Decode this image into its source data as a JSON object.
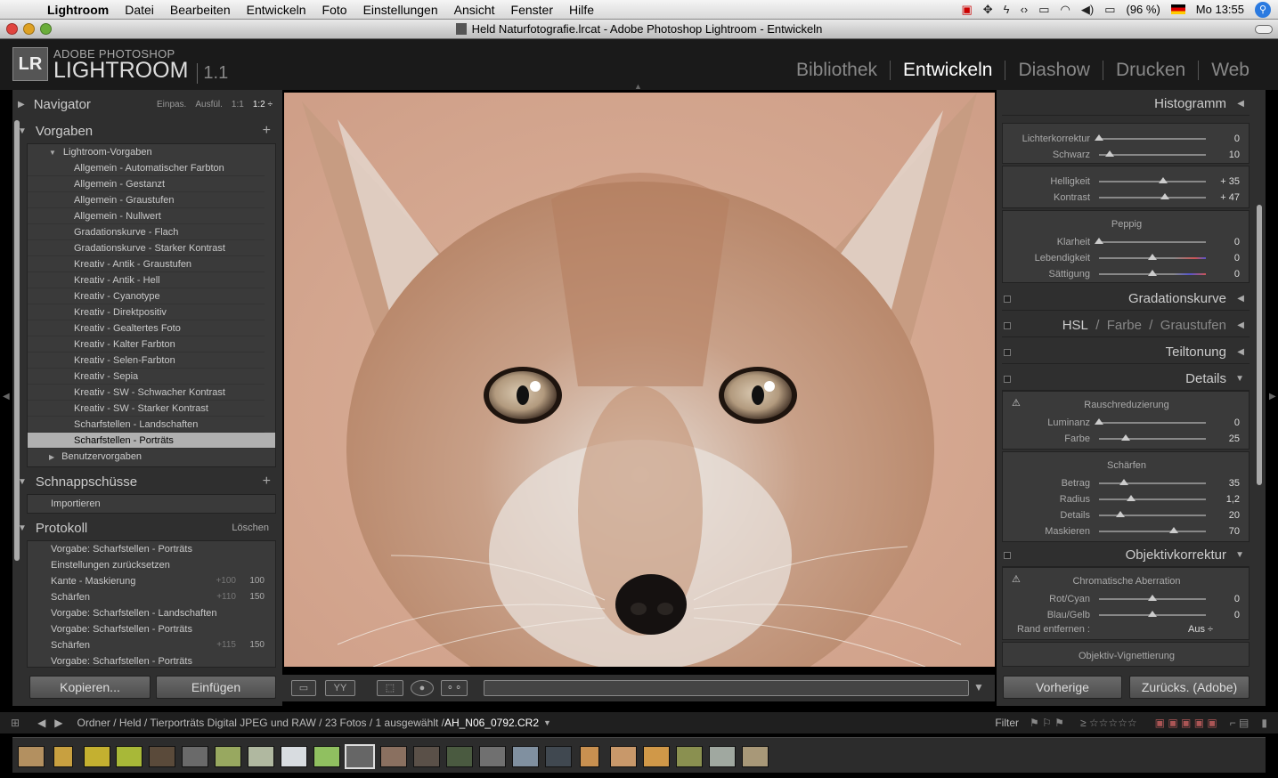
{
  "menubar": {
    "app": "Lightroom",
    "items": [
      "Datei",
      "Bearbeiten",
      "Entwickeln",
      "Foto",
      "Einstellungen",
      "Ansicht",
      "Fenster",
      "Hilfe"
    ],
    "battery": "(96 %)",
    "clock": "Mo 13:55"
  },
  "window": {
    "title": "Held Naturfotografie.lrcat - Adobe Photoshop Lightroom - Entwickeln"
  },
  "brand": {
    "small": "ADOBE PHOTOSHOP",
    "big": "LIGHTROOM",
    "version": "1.1",
    "mark": "LR"
  },
  "modules": [
    "Bibliothek",
    "Entwickeln",
    "Diashow",
    "Drucken",
    "Web"
  ],
  "navigator": {
    "title": "Navigator",
    "opts": [
      "Einpas.",
      "Ausfül.",
      "1:1",
      "1:2 ÷"
    ]
  },
  "presets": {
    "title": "Vorgaben",
    "group": "Lightroom-Vorgaben",
    "items": [
      "Allgemein - Automatischer Farbton",
      "Allgemein - Gestanzt",
      "Allgemein - Graustufen",
      "Allgemein - Nullwert",
      "Gradationskurve - Flach",
      "Gradationskurve - Starker Kontrast",
      "Kreativ - Antik - Graustufen",
      "Kreativ - Antik - Hell",
      "Kreativ - Cyanotype",
      "Kreativ - Direktpositiv",
      "Kreativ - Gealtertes Foto",
      "Kreativ - Kalter Farbton",
      "Kreativ - Selen-Farbton",
      "Kreativ - Sepia",
      "Kreativ - SW - Schwacher Kontrast",
      "Kreativ - SW - Starker Kontrast",
      "Scharfstellen - Landschaften",
      "Scharfstellen - Porträts"
    ],
    "selected": "Scharfstellen - Porträts",
    "user": "Benutzervorgaben"
  },
  "snapshots": {
    "title": "Schnappschüsse",
    "items": [
      "Importieren"
    ]
  },
  "history": {
    "title": "Protokoll",
    "clear": "Löschen",
    "items": [
      {
        "label": "Vorgabe: Scharfstellen - Porträts",
        "a": "",
        "b": ""
      },
      {
        "label": "Einstellungen zurücksetzen",
        "a": "",
        "b": ""
      },
      {
        "label": "Kante - Maskierung",
        "a": "+100",
        "b": "100"
      },
      {
        "label": "Schärfen",
        "a": "+110",
        "b": "150"
      },
      {
        "label": "Vorgabe: Scharfstellen - Landschaften",
        "a": "",
        "b": ""
      },
      {
        "label": "Vorgabe: Scharfstellen - Porträts",
        "a": "",
        "b": ""
      },
      {
        "label": "Schärfen",
        "a": "+115",
        "b": "150"
      },
      {
        "label": "Vorgabe: Scharfstellen - Porträts",
        "a": "",
        "b": ""
      }
    ]
  },
  "leftButtons": {
    "copy": "Kopieren...",
    "paste": "Einfügen"
  },
  "right": {
    "histogram": "Histogramm",
    "tone": [
      {
        "label": "Lichterkorrektur",
        "value": "0",
        "pos": 0
      },
      {
        "label": "Schwarz",
        "value": "10",
        "pos": 0.1
      }
    ],
    "tone2": [
      {
        "label": "Helligkeit",
        "value": "+ 35",
        "pos": 0.6
      },
      {
        "label": "Kontrast",
        "value": "+ 47",
        "pos": 0.62
      }
    ],
    "presence": {
      "title": "Peppig",
      "rows": [
        {
          "label": "Klarheit",
          "value": "0",
          "pos": 0
        },
        {
          "label": "Lebendigkeit",
          "value": "0",
          "pos": 0.5
        },
        {
          "label": "Sättigung",
          "value": "0",
          "pos": 0.5
        }
      ]
    },
    "curve": "Gradationskurve",
    "hsl": {
      "a": "HSL",
      "b": "Farbe",
      "c": "Graustufen",
      "sep": "/"
    },
    "split": "Teiltonung",
    "details": "Details",
    "noise": {
      "title": "Rauschreduzierung",
      "rows": [
        {
          "label": "Luminanz",
          "value": "0",
          "pos": 0
        },
        {
          "label": "Farbe",
          "value": "25",
          "pos": 0.25
        }
      ]
    },
    "sharp": {
      "title": "Schärfen",
      "rows": [
        {
          "label": "Betrag",
          "value": "35",
          "pos": 0.23
        },
        {
          "label": "Radius",
          "value": "1,2",
          "pos": 0.3
        },
        {
          "label": "Details",
          "value": "20",
          "pos": 0.2
        },
        {
          "label": "Maskieren",
          "value": "70",
          "pos": 0.7
        }
      ]
    },
    "lens": "Objektivkorrektur",
    "ca": {
      "title": "Chromatische Aberration",
      "rows": [
        {
          "label": "Rot/Cyan",
          "value": "0",
          "pos": 0.5
        },
        {
          "label": "Blau/Gelb",
          "value": "0",
          "pos": 0.5
        }
      ],
      "fringe": "Rand entfernen :",
      "fringeVal": "Aus ÷"
    },
    "vign": "Objektiv-Vignettierung",
    "prev": "Vorherige",
    "reset": "Zurücks. (Adobe)"
  },
  "filmbar": {
    "path": "Ordner / Held / Tierporträts Digital JPEG und RAW / 23 Fotos / 1 ausgewählt / ",
    "file": "AH_N06_0792.CR2",
    "filter": "Filter"
  }
}
